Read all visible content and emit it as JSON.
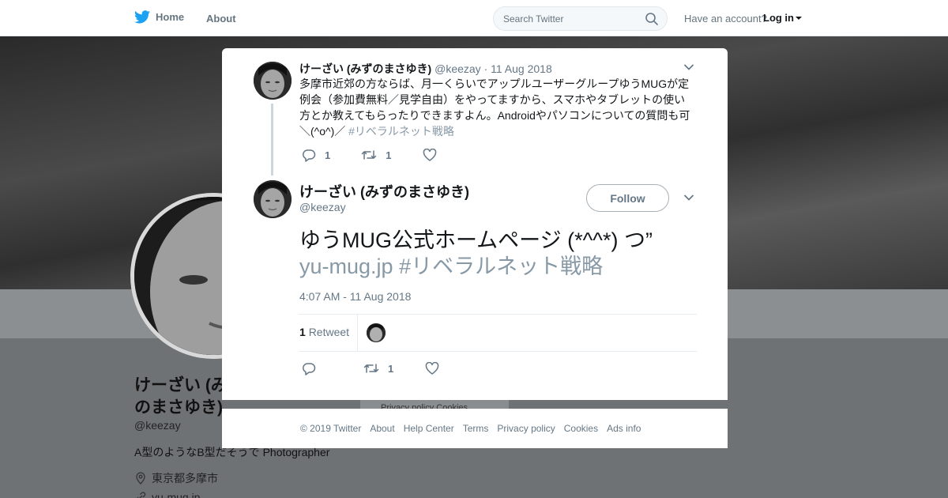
{
  "nav": {
    "home": "Home",
    "about": "About",
    "search_placeholder": "Search Twitter",
    "have_account": "Have an account?",
    "login": "Log in"
  },
  "profile": {
    "name": "けーざい (みずのまさゆき)",
    "handle": "@keezay",
    "bio": "A型のようなB型だそうで Photographer",
    "location": "東京都多摩市",
    "url": "yu-mug.jp",
    "card_text": "Privacy policy  Cookies"
  },
  "parent_tweet": {
    "name": "けーざい (みずのまさゆき)",
    "handle": "@keezay",
    "dot": "·",
    "date": "11 Aug 2018",
    "text": "多摩市近郊の方ならば、月一くらいでアップルユーザーグループゆうMUGが定例会（参加費無料／見学自由）をやってますから、スマホやタブレットの使い方とか教えてもらったりできますよん。Androidやパソコンについての質問も可＼(^o^)／ ",
    "hashtag": "#リベラルネット戦略",
    "reply_count": "1",
    "retweet_count": "1"
  },
  "main_tweet": {
    "name": "けーざい (みずのまさゆき)",
    "handle": "@keezay",
    "follow_label": "Follow",
    "text": "ゆうMUG公式ホームページ (*^^*) つ”",
    "link": " yu-mug.jp",
    "hashtag": "#リベラルネット戦略",
    "timestamp": "4:07 AM - 11 Aug 2018",
    "retweet_count": "1",
    "retweet_label": "Retweet",
    "action_retweet_count": "1"
  },
  "footer": {
    "copyright": "© 2019 Twitter",
    "about": "About",
    "help": "Help Center",
    "terms": "Terms",
    "privacy": "Privacy policy",
    "cookies": "Cookies",
    "ads": "Ads info"
  },
  "colors": {
    "twitter_blue": "#1da1f2",
    "muted_text": "#657786",
    "link_gray": "#8899a6",
    "overlay_bg": "#3b3b3b"
  }
}
